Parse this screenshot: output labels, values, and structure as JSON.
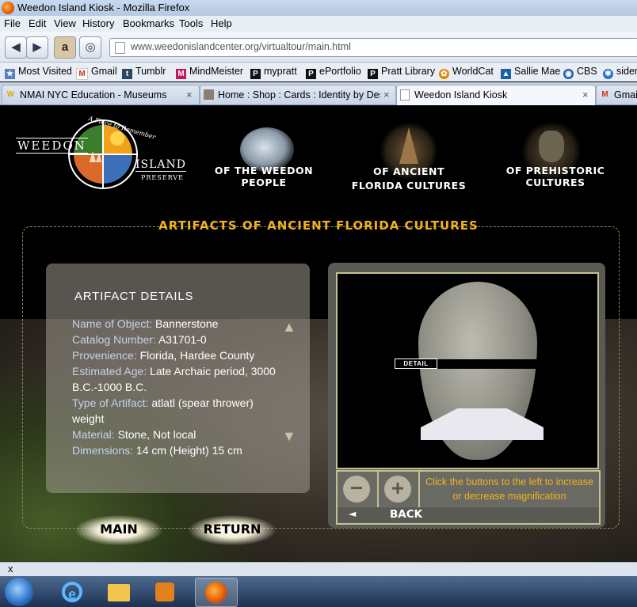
{
  "window": {
    "title": "Weedon Island Kiosk - Mozilla Firefox"
  },
  "menu": [
    "File",
    "Edit",
    "View",
    "History",
    "Bookmarks",
    "Tools",
    "Help"
  ],
  "address": {
    "url": "www.weedonislandcenter.org/virtualtour/main.html"
  },
  "bookmarks": [
    {
      "label": "Most Visited",
      "icon": "star-icon",
      "color": "#5a7fc0"
    },
    {
      "label": "Gmail",
      "icon": "gmail-icon",
      "color": "#d62d20"
    },
    {
      "label": "Tumblr",
      "icon": "tumblr-icon",
      "color": "#2c4762"
    },
    {
      "label": "MindMeister",
      "icon": "mindmeister-icon",
      "color": "#c2185b"
    },
    {
      "label": "mypratt",
      "icon": "pratt-icon",
      "color": "#111111"
    },
    {
      "label": "ePortfolio",
      "icon": "pratt-icon",
      "color": "#111111"
    },
    {
      "label": "Pratt Library",
      "icon": "pratt-icon",
      "color": "#111111"
    },
    {
      "label": "WorldCat",
      "icon": "worldcat-icon",
      "color": "#e08a00"
    },
    {
      "label": "Sallie Mae",
      "icon": "salliemae-icon",
      "color": "#1a5fa8"
    },
    {
      "label": "CBS",
      "icon": "cbs-icon",
      "color": "#1a5fa8"
    },
    {
      "label": "sider",
      "icon": "sider-icon",
      "color": "#2b6fc8"
    }
  ],
  "tabs": [
    {
      "label": "NMAI NYC Education - Museums",
      "icon": "nmai-icon",
      "active": false
    },
    {
      "label": "Home : Shop : Cards : Identity by Desi...",
      "icon": "shop-icon",
      "active": false
    },
    {
      "label": "Weedon Island Kiosk",
      "icon": "page-icon",
      "active": true
    },
    {
      "label": "Gmail",
      "icon": "gmail-icon",
      "active": false
    }
  ],
  "site": {
    "logo": {
      "text_left": "WEEDON",
      "text_right": "ISLAND",
      "tagline": "A Place to Remember",
      "sub": "PRESERVE"
    },
    "nav": [
      {
        "label": "OF THE WEEDON PEOPLE"
      },
      {
        "label": "OF ANCIENT FLORIDA CULTURES"
      },
      {
        "label": "OF PREHISTORIC CULTURES"
      }
    ],
    "heading": "ARTIFACTS OF ANCIENT FLORIDA CULTURES",
    "details": {
      "title": "ARTIFACT DETAILS",
      "rows": [
        {
          "k": "Name of Object:",
          "v": "Bannerstone"
        },
        {
          "k": "Catalog Number:",
          "v": "A31701-0"
        },
        {
          "k": "Provenience:",
          "v": "Florida, Hardee County"
        },
        {
          "k": "Estimated Age:",
          "v": "Late Archaic period, 3000 B.C.-1000 B.C."
        },
        {
          "k": "Type of Artifact:",
          "v": "atlatl (spear thrower) weight"
        },
        {
          "k": "Material:",
          "v": "Stone, Not local"
        },
        {
          "k": "Dimensions:",
          "v": "14 cm (Height) 15 cm"
        }
      ]
    },
    "viewer": {
      "detail_tag": "DETAIL",
      "hint": "Click the buttons to the  left to increase or decrease magnification",
      "back": "BACK",
      "minus": "−",
      "plus": "+"
    },
    "main_button": "MAIN",
    "return_button": "RETURN"
  },
  "status": {
    "close": "x"
  }
}
